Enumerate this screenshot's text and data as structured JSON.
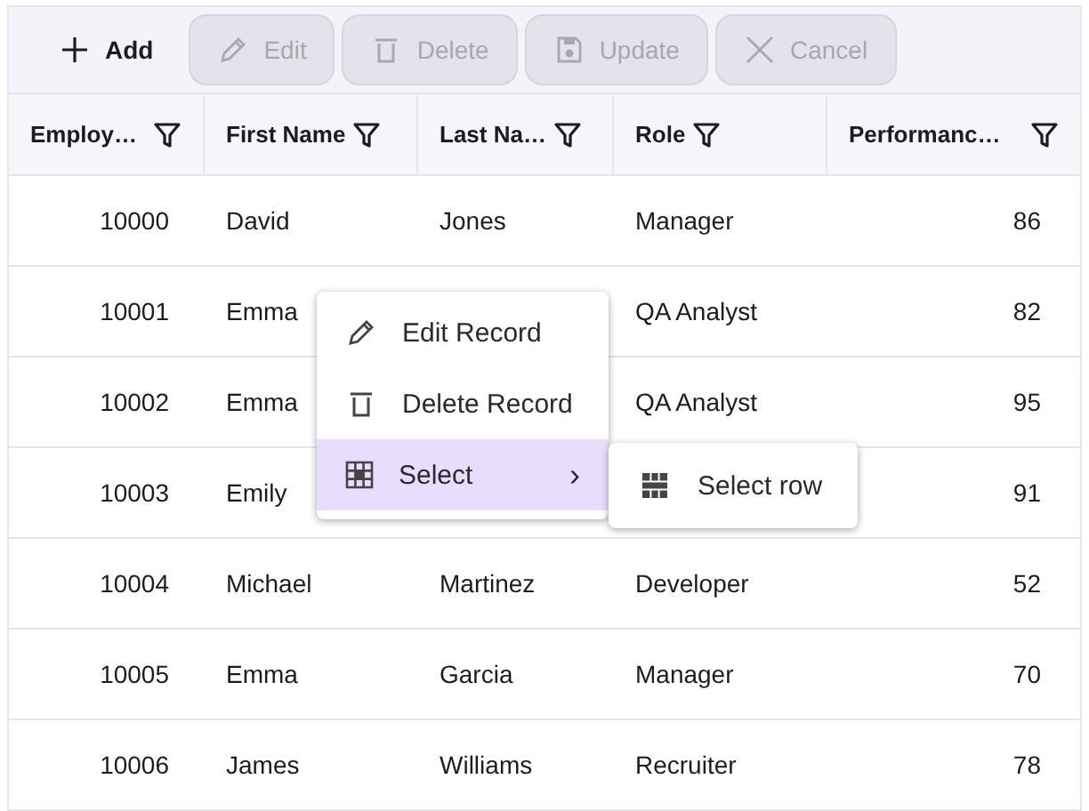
{
  "toolbar": [
    {
      "label": "Add",
      "disabled": false
    },
    {
      "label": "Edit",
      "disabled": true
    },
    {
      "label": "Delete",
      "disabled": true
    },
    {
      "label": "Update",
      "disabled": true
    },
    {
      "label": "Cancel",
      "disabled": true
    }
  ],
  "table": {
    "columns": [
      {
        "label": "Employ…"
      },
      {
        "label": "First Name"
      },
      {
        "label": "Last Na…"
      },
      {
        "label": "Role"
      },
      {
        "label": "Performanc…"
      }
    ],
    "rows": [
      {
        "cells": [
          "10000",
          "David",
          "Jones",
          "Manager",
          "86"
        ]
      },
      {
        "cells": [
          "10001",
          "Emma",
          null,
          "QA Analyst",
          "82"
        ]
      },
      {
        "cells": [
          "10002",
          "Emma",
          null,
          "QA Analyst",
          "95"
        ]
      },
      {
        "cells": [
          "10003",
          "Emily",
          null,
          null,
          "91"
        ]
      },
      {
        "cells": [
          "10004",
          "Michael",
          "Martinez",
          "Developer",
          "52"
        ]
      },
      {
        "cells": [
          "10005",
          "Emma",
          "Garcia",
          "Manager",
          "70"
        ]
      },
      {
        "cells": [
          "10006",
          "James",
          "Williams",
          "Recruiter",
          "78"
        ]
      }
    ]
  },
  "context_menu": {
    "items": [
      {
        "label": "Edit Record",
        "selected": false
      },
      {
        "label": "Delete Record",
        "selected": false
      },
      {
        "label": "Select",
        "selected": true,
        "chevron": "›"
      }
    ],
    "submenu": {
      "items": [
        {
          "label": "Select row"
        }
      ]
    }
  }
}
